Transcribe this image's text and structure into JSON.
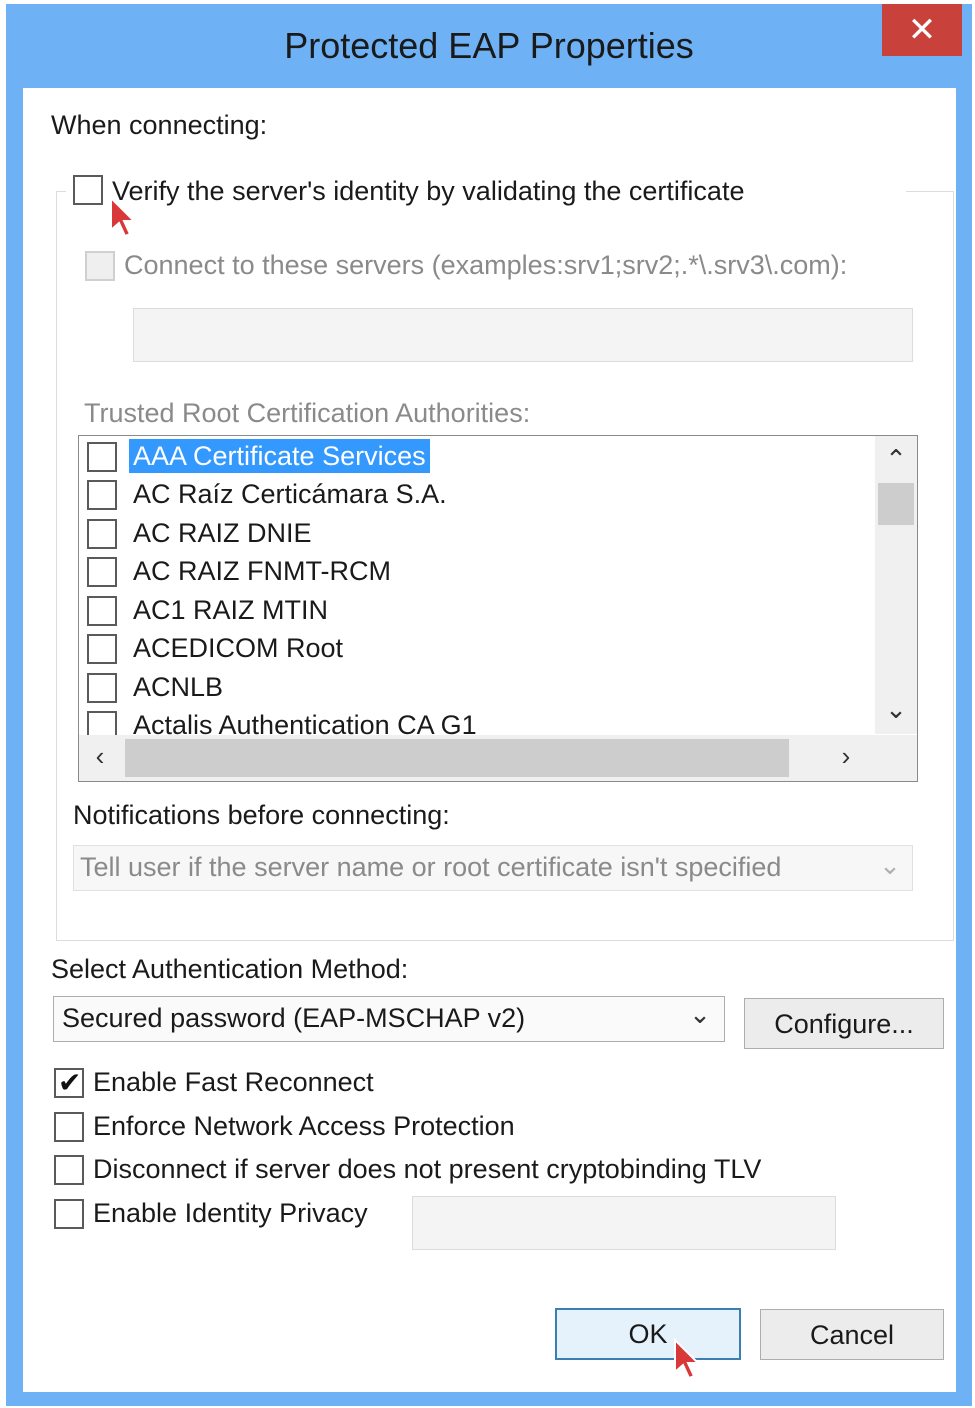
{
  "window": {
    "title": "Protected EAP Properties",
    "close_icon": "close-icon"
  },
  "when_connecting_label": "When connecting:",
  "verify_identity": {
    "label": "Verify the server's identity by validating the certificate",
    "checked": false
  },
  "connect_servers": {
    "label": "Connect to these servers (examples:srv1;srv2;.*\\.srv3\\.com):",
    "checked": false,
    "value": ""
  },
  "trusted_roots": {
    "label": "Trusted Root Certification Authorities:",
    "items": [
      {
        "label": "AAA Certificate Services",
        "checked": false,
        "selected": true
      },
      {
        "label": "AC Raíz Certicámara S.A.",
        "checked": false
      },
      {
        "label": "AC RAIZ DNIE",
        "checked": false
      },
      {
        "label": "AC RAIZ FNMT-RCM",
        "checked": false
      },
      {
        "label": "AC1 RAIZ MTIN",
        "checked": false
      },
      {
        "label": "ACEDICOM Root",
        "checked": false
      },
      {
        "label": "ACNLB",
        "checked": false
      },
      {
        "label": "Actalis Authentication CA G1",
        "checked": false
      }
    ]
  },
  "notifications": {
    "label": "Notifications before connecting:",
    "value": "Tell user if the server name or root certificate isn't specified"
  },
  "auth_method": {
    "label": "Select Authentication Method:",
    "value": "Secured password (EAP-MSCHAP v2)",
    "configure_label": "Configure..."
  },
  "options": [
    {
      "label": "Enable Fast Reconnect",
      "checked": true
    },
    {
      "label": "Enforce Network Access Protection",
      "checked": false
    },
    {
      "label": "Disconnect if server does not present cryptobinding TLV",
      "checked": false
    },
    {
      "label": "Enable Identity Privacy",
      "checked": false
    }
  ],
  "identity_privacy_value": "",
  "buttons": {
    "ok": "OK",
    "cancel": "Cancel"
  },
  "colors": {
    "titlebar": "#6fb1f5",
    "close": "#c8413a",
    "selection": "#3399ff"
  }
}
